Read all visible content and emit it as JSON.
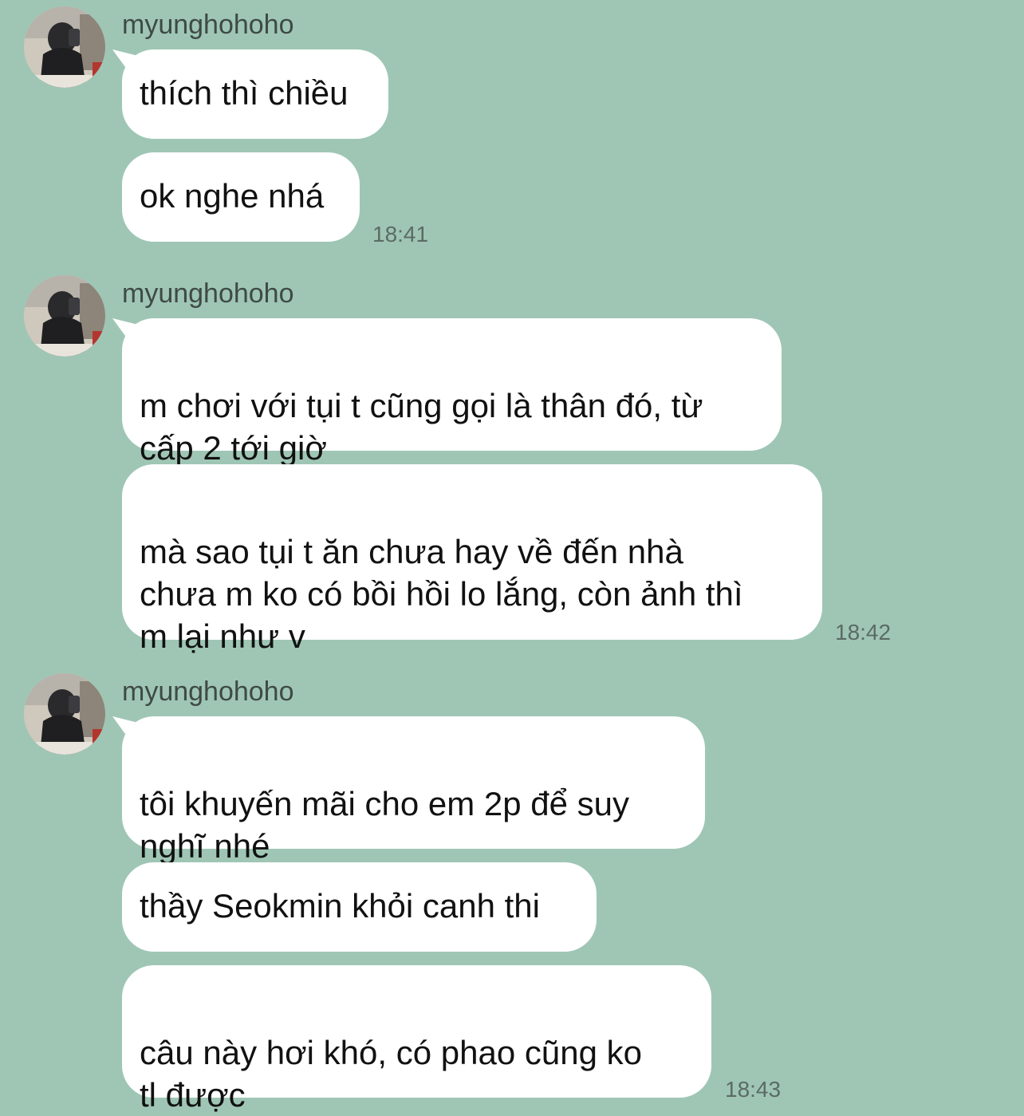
{
  "groups": [
    {
      "sender": "myunghohoho",
      "messages": [
        "thích thì chiều",
        "ok nghe nhá"
      ],
      "time": "18:41"
    },
    {
      "sender": "myunghohoho",
      "messages": [
        "m chơi với tụi t cũng gọi là thân đó, từ\ncấp 2 tới giờ",
        "mà sao tụi t ăn chưa hay về đến nhà\nchưa m ko có bồi hồi lo lắng, còn ảnh thì\nm lại như v"
      ],
      "time": "18:42"
    },
    {
      "sender": "myunghohoho",
      "messages": [
        "tôi khuyến mãi cho em 2p để suy\nnghĩ nhé",
        "thầy Seokmin khỏi canh thi",
        "câu này hơi khó, có phao cũng ko\ntl được"
      ],
      "time": "18:43"
    }
  ],
  "colors": {
    "background": "#9fc6b5",
    "bubble": "#ffffff",
    "text": "#111111",
    "meta_text": "#5b6b64"
  },
  "icons": {
    "avatar": "user-photo-avatar"
  }
}
